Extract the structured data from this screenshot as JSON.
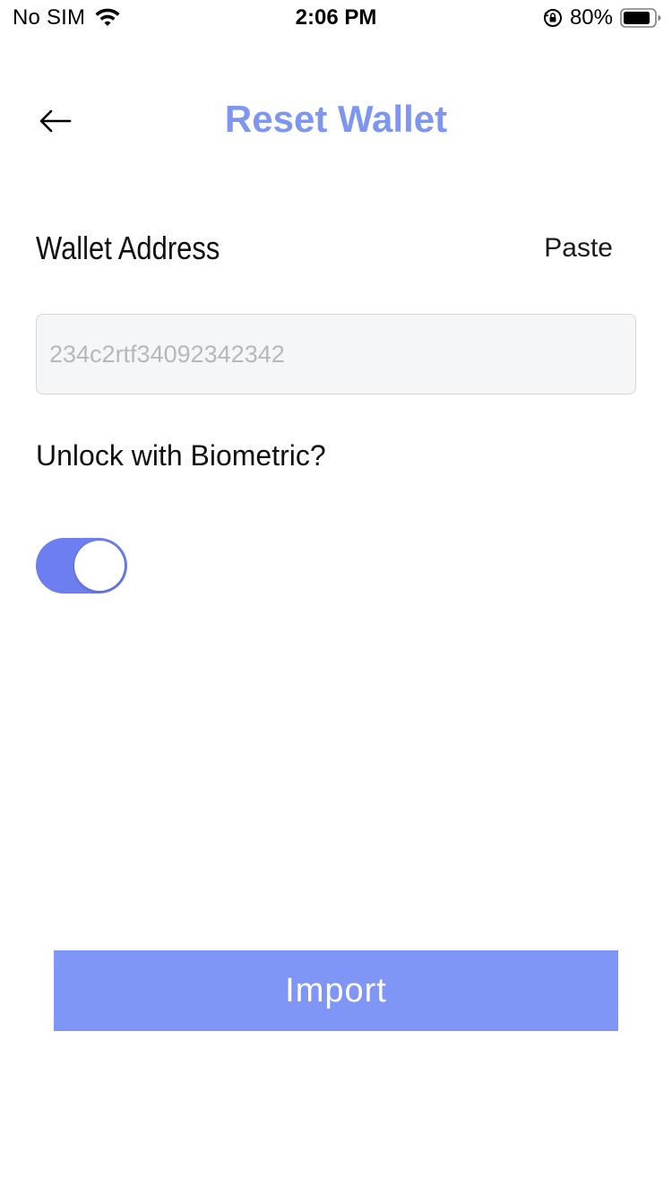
{
  "status_bar": {
    "carrier": "No SIM",
    "time": "2:06 PM",
    "battery": "80%",
    "icons": [
      "wifi-icon",
      "orientation-lock-icon",
      "battery-icon"
    ]
  },
  "header": {
    "title": "Reset Wallet",
    "back_icon": "arrow-left-icon"
  },
  "form": {
    "address_label": "Wallet Address",
    "paste_label": "Paste",
    "address_placeholder": "234c2rtf34092342342",
    "address_value": "",
    "biometric_label": "Unlock with Biometric?",
    "biometric_enabled": true
  },
  "actions": {
    "import_label": "Import"
  },
  "colors": {
    "accent": "#7f96f0",
    "toggle_on": "#6d7ff0",
    "button_bg": "#7f96f6",
    "input_bg": "#f5f6f8"
  }
}
